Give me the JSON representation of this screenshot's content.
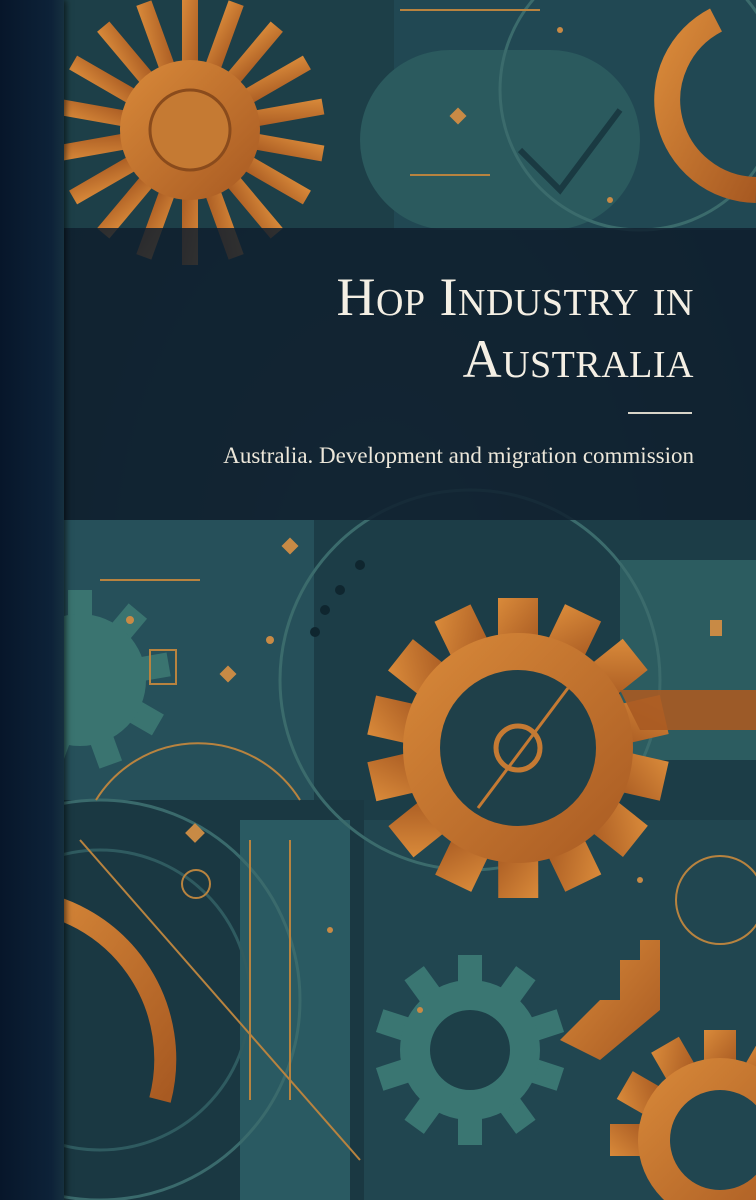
{
  "cover": {
    "title_line1": "Hop Industry in",
    "title_line2": "Australia",
    "author": "Australia. Development and migration commission"
  }
}
